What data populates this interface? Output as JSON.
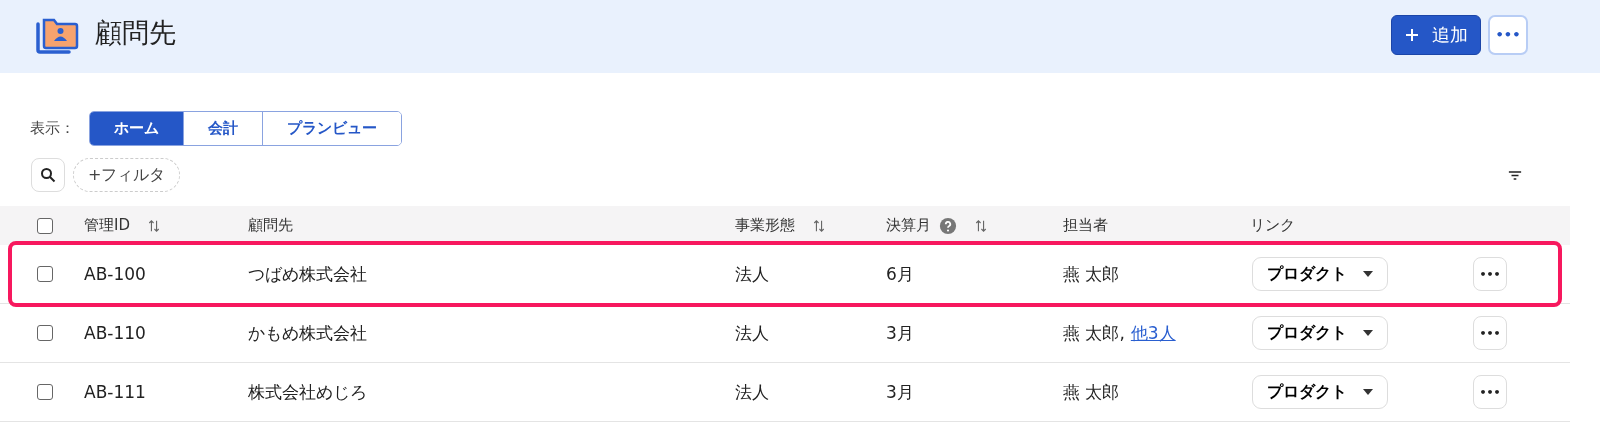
{
  "page": {
    "title": "顧問先",
    "add_button": "追加",
    "more_button": "•••"
  },
  "view": {
    "label": "表示：",
    "tabs": [
      {
        "label": "ホーム",
        "selected": true
      },
      {
        "label": "会計",
        "selected": false
      },
      {
        "label": "プランビュー",
        "selected": false
      }
    ]
  },
  "filter": {
    "label": "+フィルタ"
  },
  "table": {
    "columns": [
      {
        "label": "管理ID",
        "kind": "sortable"
      },
      {
        "label": "顧問先",
        "kind": "plain"
      },
      {
        "label": "事業形態",
        "kind": "sortable"
      },
      {
        "label": "決算月",
        "kind": "help_sortable"
      },
      {
        "label": "担当者",
        "kind": "plain"
      },
      {
        "label": "リンク",
        "kind": "plain"
      }
    ],
    "header_checked": false,
    "rows": [
      {
        "checked": false,
        "highlighted": true,
        "id": "AB-100",
        "client": "つばめ株式会社",
        "type": "法人",
        "month": "6月",
        "assignee": "燕 太郎",
        "link": "プロダクト",
        "more": "•••"
      },
      {
        "checked": false,
        "highlighted": false,
        "id": "AB-110",
        "client": "かもめ株式会社",
        "type": "法人",
        "month": "3月",
        "assignee": "燕 太郎,",
        "others": "他3人",
        "link": "プロダクト",
        "more": "•••"
      },
      {
        "checked": false,
        "highlighted": false,
        "id": "AB-111",
        "client": "株式会社めじろ",
        "type": "法人",
        "month": "3月",
        "assignee": "燕 太郎",
        "link": "プロダクト",
        "more": "•••"
      }
    ]
  }
}
